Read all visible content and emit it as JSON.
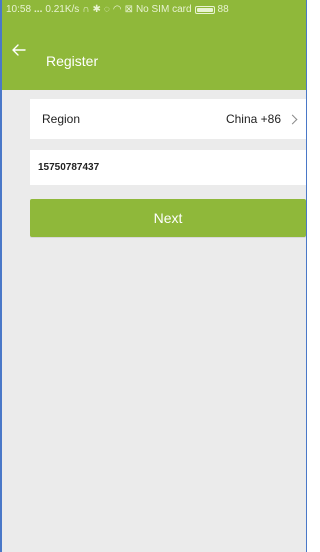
{
  "status_bar": {
    "time": "10:58",
    "dots": "...",
    "speed": "0.21K/s",
    "carrier": "No SIM card",
    "battery": "88"
  },
  "toolbar": {
    "title": "Register"
  },
  "region": {
    "label": "Region",
    "value": "China +86"
  },
  "phone": {
    "value": "15750787437"
  },
  "next_button": {
    "label": "Next"
  },
  "colors": {
    "accent": "#8fb83a",
    "background": "#ebebeb",
    "frame_border": "#4a78c8"
  },
  "icons": {
    "back": "arrow-left-icon",
    "chevron": "chevron-right-icon",
    "headphones": "headphones-icon",
    "bluetooth": "bluetooth-icon",
    "alarm": "alarm-icon",
    "wifi": "wifi-icon",
    "sim": "sim-x-icon",
    "battery": "battery-icon"
  }
}
